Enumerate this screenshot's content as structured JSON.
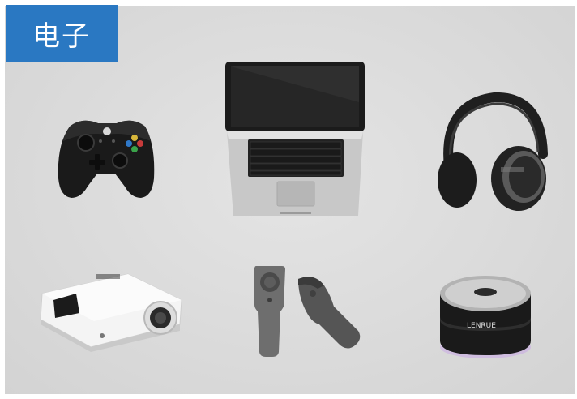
{
  "category": {
    "label": "电子"
  },
  "products": [
    {
      "id": "controller",
      "icon": "game-controller-icon"
    },
    {
      "id": "laptop",
      "icon": "laptop-icon"
    },
    {
      "id": "headphones",
      "icon": "headphones-icon"
    },
    {
      "id": "projector",
      "icon": "projector-icon"
    },
    {
      "id": "vr-controllers",
      "icon": "vr-controller-icon"
    },
    {
      "id": "speaker",
      "icon": "bluetooth-speaker-icon"
    }
  ],
  "labels": {
    "speaker_brand": "LENRUE"
  }
}
